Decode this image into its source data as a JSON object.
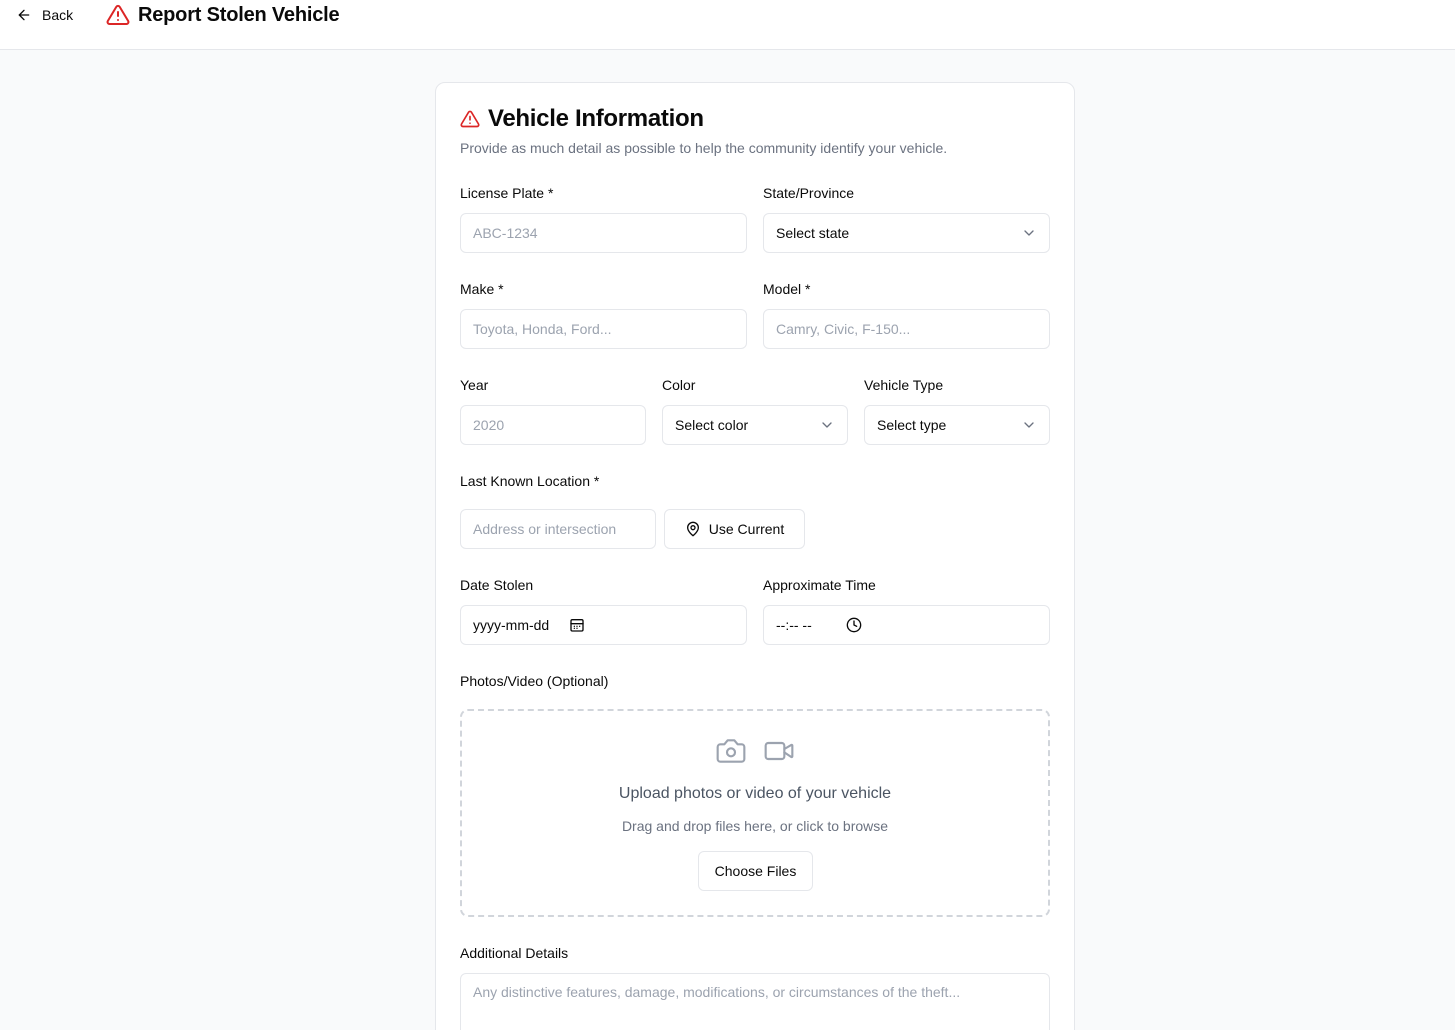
{
  "header": {
    "back_label": "Back",
    "title": "Report Stolen Vehicle",
    "accent_color": "#dc2626"
  },
  "card": {
    "title": "Vehicle Information",
    "description": "Provide as much detail as possible to help the community identify your vehicle."
  },
  "fields": {
    "license_plate": {
      "label": "License Plate *",
      "placeholder": "ABC-1234"
    },
    "state": {
      "label": "State/Province",
      "value": "Select state"
    },
    "make": {
      "label": "Make *",
      "placeholder": "Toyota, Honda, Ford..."
    },
    "model": {
      "label": "Model *",
      "placeholder": "Camry, Civic, F-150..."
    },
    "year": {
      "label": "Year",
      "placeholder": "2020"
    },
    "color": {
      "label": "Color",
      "value": "Select color"
    },
    "vehicle_type": {
      "label": "Vehicle Type",
      "value": "Select type"
    },
    "location": {
      "label": "Last Known Location *",
      "placeholder": "Address or intersection",
      "use_current_label": "Use Current"
    },
    "date_stolen": {
      "label": "Date Stolen",
      "value": "yyyy-mm-dd"
    },
    "time": {
      "label": "Approximate Time",
      "value": "--:-- --"
    },
    "additional": {
      "label": "Additional Details",
      "placeholder": "Any distinctive features, damage, modifications, or circumstances of the theft..."
    }
  },
  "upload": {
    "label": "Photos/Video (Optional)",
    "title": "Upload photos or video of your vehicle",
    "subtitle": "Drag and drop files here, or click to browse",
    "button_label": "Choose Files"
  },
  "icons": {
    "back": "arrow-left-icon",
    "alert": "alert-triangle-icon",
    "chevron": "chevron-down-icon",
    "location": "map-pin-icon",
    "calendar": "calendar-icon",
    "clock": "clock-icon",
    "camera": "camera-icon",
    "video": "video-icon"
  }
}
